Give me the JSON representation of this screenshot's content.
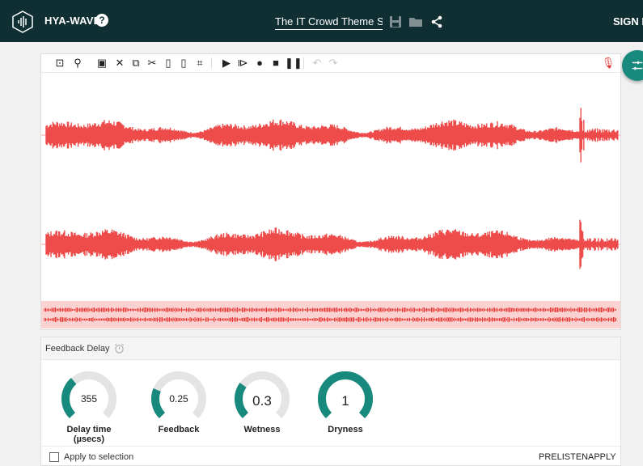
{
  "app": {
    "brand": "HYA-WAVE",
    "help_icon": "?",
    "sign_in": "SIGN IN"
  },
  "file": {
    "title": "The IT Crowd Theme Song"
  },
  "toolbar": {
    "tools": [
      "zoom-selection-icon",
      "zoom-icon",
      "select-all-icon",
      "delete-icon",
      "copy-icon",
      "cut-icon",
      "paste-icon",
      "paste-new-icon",
      "crop-icon",
      "play-icon",
      "play-selection-icon",
      "record-icon",
      "stop-icon",
      "pause-icon",
      "undo-icon",
      "redo-icon",
      "microphone-icon"
    ]
  },
  "colors": {
    "topbar": "#0f2f33",
    "waveform": "#ee4b4b",
    "overview_bg": "#fbd2d2",
    "accent": "#17897d"
  },
  "effect": {
    "name": "Feedback Delay",
    "knobs": [
      {
        "value": "355",
        "label": "Delay time (µsecs)",
        "fraction": 0.35
      },
      {
        "value": "0.25",
        "label": "Feedback",
        "fraction": 0.25
      },
      {
        "value": "0.3",
        "label": "Wetness",
        "fraction": 0.3
      },
      {
        "value": "1",
        "label": "Dryness",
        "fraction": 1.0
      }
    ],
    "apply_to_selection": "Apply to selection",
    "prelisten": "PRELISTEN",
    "apply": "APPLY"
  }
}
